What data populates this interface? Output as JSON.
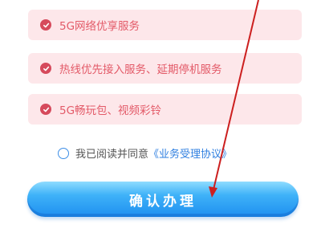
{
  "benefits": [
    {
      "label": "5G网络优享服务"
    },
    {
      "label": "热线优先接入服务、延期停机服务"
    },
    {
      "label": "5G畅玩包、视频彩铃"
    }
  ],
  "agreement": {
    "prefix": "我已阅读并同意",
    "link": "《业务受理协议》",
    "checked": false
  },
  "confirm_button": {
    "label": "确认办理"
  },
  "colors": {
    "benefit_bg": "#fde7ea",
    "benefit_text": "#e35a68",
    "check_bg": "#d64a5c",
    "link": "#2f7fe0",
    "button_blue": "#1e8ff0",
    "annotation_arrow": "#cc1f1f"
  }
}
